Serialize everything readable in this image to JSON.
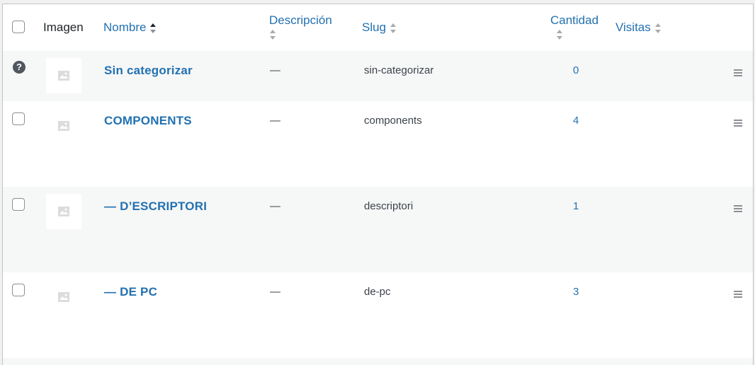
{
  "header": {
    "image": "Imagen",
    "name": "Nombre",
    "description": "Descripción",
    "slug": "Slug",
    "count": "Cantidad",
    "visits": "Visitas"
  },
  "rows": [
    {
      "name": "Sin categorizar",
      "description": "—",
      "slug": "sin-categorizar",
      "count": "0"
    },
    {
      "name": "COMPONENTS",
      "description": "—",
      "slug": "components",
      "count": "4"
    },
    {
      "name": "— D’ESCRIPTORI",
      "description": "—",
      "slug": "descriptori",
      "count": "1"
    },
    {
      "name": "— DE PC",
      "description": "—",
      "slug": "de-pc",
      "count": "3"
    }
  ],
  "colors": {
    "link": "#2271b1",
    "row_alt": "#f6f7f7",
    "border": "#c3c4c7"
  },
  "icons": {
    "help": "question-circle-icon",
    "placeholder": "image-placeholder-icon",
    "drag": "drag-handle-icon"
  }
}
